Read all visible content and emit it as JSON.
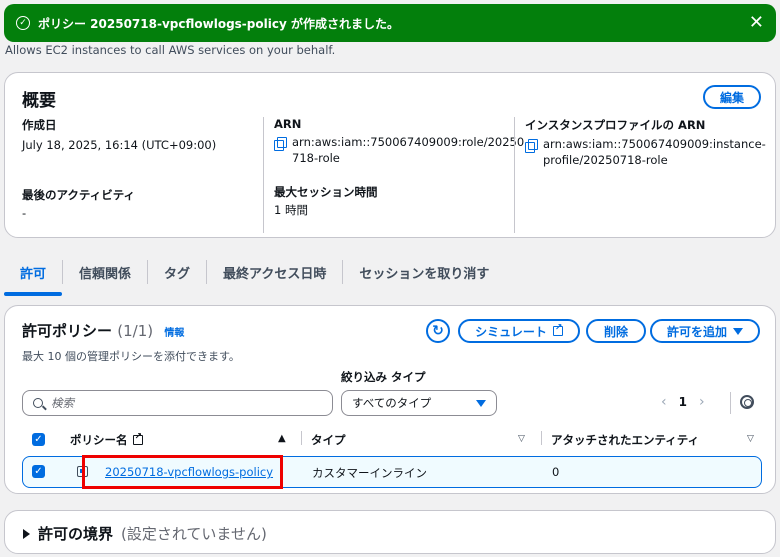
{
  "flash": {
    "message": "ポリシー 20250718-vpcflowlogs-policy が作成されました。",
    "close": "✕"
  },
  "description": "Allows EC2 instances to call AWS services on your behalf.",
  "summary": {
    "title": "概要",
    "edit_label": "編集",
    "created_label": "作成日",
    "created_value": "July 18, 2025, 16:14 (UTC+09:00)",
    "last_activity_label": "最後のアクティビティ",
    "last_activity_value": "-",
    "arn_label": "ARN",
    "arn_value_1": "arn:aws:iam::750067409009:role/20250",
    "arn_value_2": "718-role",
    "max_session_label": "最大セッション時間",
    "max_session_value": "1 時間",
    "profile_arn_label": "インスタンスプロファイルの ARN",
    "profile_arn_value_1": "arn:aws:iam::750067409009:instance-",
    "profile_arn_value_2": "profile/20250718-role"
  },
  "tabs": [
    "許可",
    "信頼関係",
    "タグ",
    "最終アクセス日時",
    "セッションを取り消す"
  ],
  "permissions": {
    "title": "許可ポリシー",
    "count": "(1/1)",
    "info": "情報",
    "subtitle": "最大 10 個の管理ポリシーを添付できます。",
    "simulate_label": "シミュレート",
    "delete_label": "削除",
    "add_label": "許可を追加",
    "filter_label": "絞り込み タイプ",
    "search_placeholder": "検索",
    "filter_value": "すべてのタイプ",
    "page": "1",
    "col_name": "ポリシー名",
    "col_type": "タイプ",
    "col_attached": "アタッチされたエンティティ",
    "rows": [
      {
        "name": "20250718-vpcflowlogs-policy",
        "type": "カスタマーインライン",
        "attached": "0"
      }
    ]
  },
  "boundary": {
    "title": "許可の境界",
    "status": "(設定されていません)"
  },
  "colors": {
    "accent": "#006ce0",
    "success": "#037f0c",
    "highlight": "#e00000"
  }
}
